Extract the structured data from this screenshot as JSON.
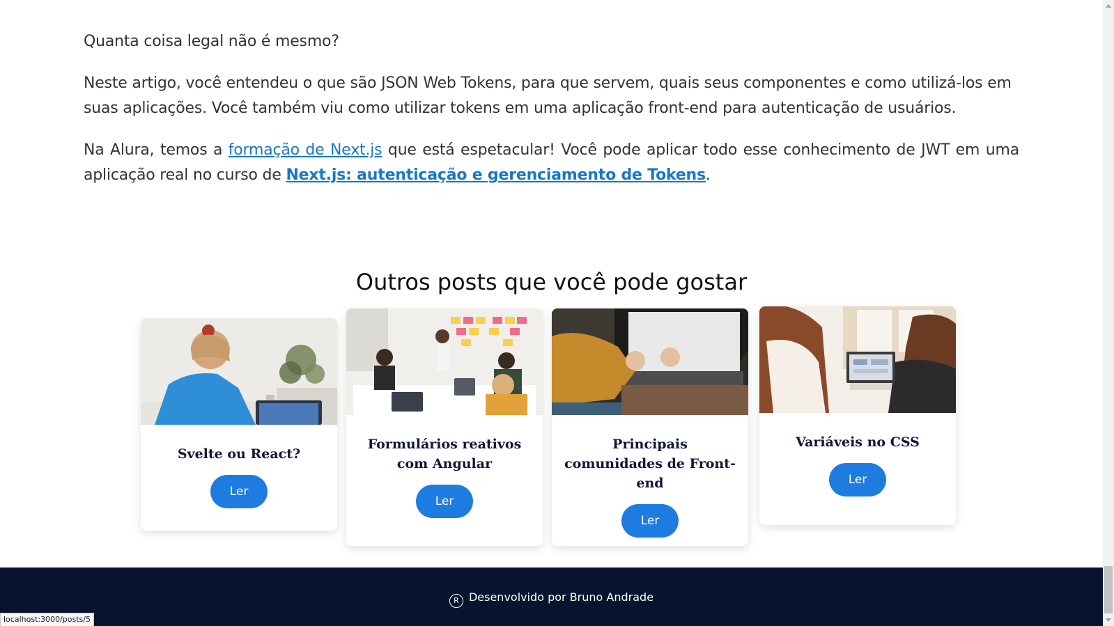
{
  "article": {
    "p1": "Quanta coisa legal não é mesmo?",
    "p2": "Neste artigo, você entendeu o que são JSON Web Tokens, para que servem, quais seus componentes e como utilizá-los em suas aplicações. Você também viu como utilizar tokens em uma aplicação front-end para autenticação de usuários.",
    "p3_before_link1": "Na Alura, temos a ",
    "p3_link1": "formação de Next.js",
    "p3_between": " que está espetacular! Você pode aplicar todo esse conhecimento de JWT em uma aplicação real no curso de ",
    "p3_link2": "Next.js: autenticação e gerenciamento de Tokens",
    "p3_after": "."
  },
  "related": {
    "title": "Outros posts que você pode gostar",
    "button_label": "Ler",
    "posts": [
      {
        "title": "Svelte ou React?"
      },
      {
        "title": "Formulários reativos com Angular"
      },
      {
        "title": "Principais comunidades de Front-end"
      },
      {
        "title": "Variáveis no CSS"
      }
    ]
  },
  "footer": {
    "icon": "registered-icon",
    "text": "Desenvolvido por Bruno Andrade"
  },
  "status_bar": {
    "url": "localhost:3000/posts/5"
  },
  "colors": {
    "accent": "#1e7be0",
    "link": "#1877c9",
    "footer_bg": "#06142f",
    "card_title": "#10163a"
  }
}
